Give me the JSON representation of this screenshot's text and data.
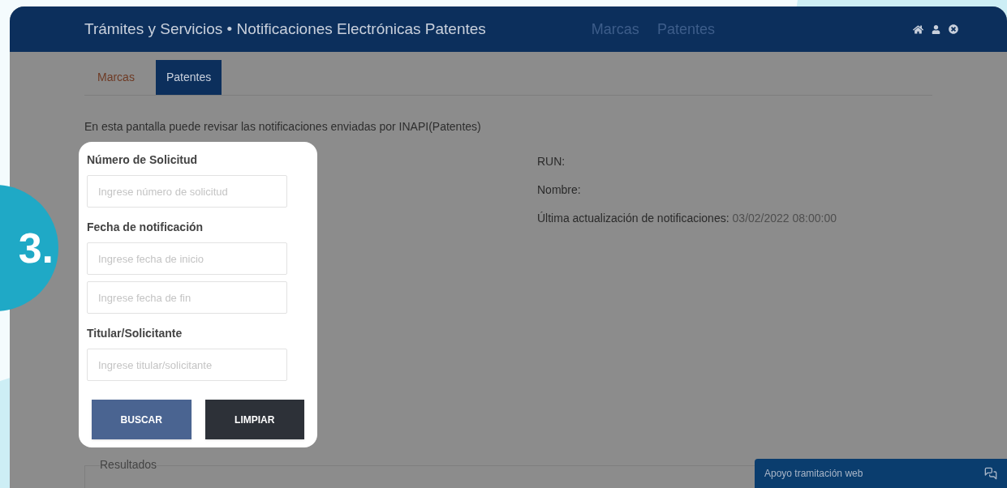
{
  "step_badge": "3.",
  "header": {
    "title": "Trámites y Servicios • Notificaciones Electrónicas Patentes",
    "nav": [
      {
        "label": "Marcas"
      },
      {
        "label": "Patentes"
      }
    ]
  },
  "tabs": [
    {
      "label": "Marcas",
      "selected": false
    },
    {
      "label": "Patentes",
      "selected": true
    }
  ],
  "intro": "En esta pantalla puede revisar las notificaciones enviadas por INAPI(Patentes)",
  "form": {
    "sections": [
      {
        "label": "Número de Solicitud",
        "fields": [
          {
            "placeholder": "Ingrese número de solicitud"
          }
        ]
      },
      {
        "label": "Fecha de notificación",
        "fields": [
          {
            "placeholder": "Ingrese fecha de inicio"
          },
          {
            "placeholder": "Ingrese fecha de fin"
          }
        ]
      },
      {
        "label": "Titular/Solicitante",
        "fields": [
          {
            "placeholder": "Ingrese titular/solicitante"
          }
        ]
      }
    ],
    "buttons": [
      {
        "label": "BUSCAR",
        "kind": "primary"
      },
      {
        "label": "LIMPIAR",
        "kind": "dark"
      }
    ]
  },
  "info": [
    {
      "label": "RUN:"
    },
    {
      "label": "Nombre:"
    },
    {
      "label": "Última actualización de notificaciones:",
      "value": "03/02/2022 08:00:00"
    }
  ],
  "results": {
    "legend": "Resultados"
  },
  "chat": {
    "label": "Apoyo tramitación web"
  }
}
